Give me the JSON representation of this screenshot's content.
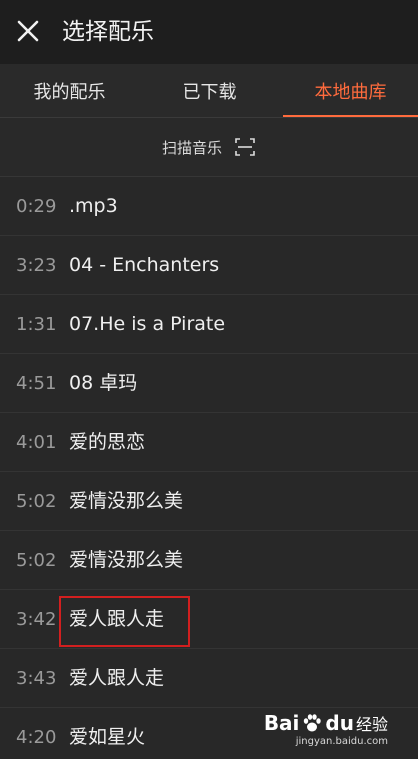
{
  "header": {
    "title": "选择配乐",
    "close_icon": "close-icon"
  },
  "tabs": [
    {
      "label": "我的配乐",
      "active": false
    },
    {
      "label": "已下载",
      "active": false
    },
    {
      "label": "本地曲库",
      "active": true
    }
  ],
  "accent_color": "#ff6b3d",
  "scan": {
    "label": "扫描音乐",
    "icon": "scan-icon"
  },
  "songs": [
    {
      "duration": "0:29",
      "title": ".mp3"
    },
    {
      "duration": "3:23",
      "title": "04 - Enchanters"
    },
    {
      "duration": "1:31",
      "title": "07.He is a Pirate"
    },
    {
      "duration": "4:51",
      "title": "08 卓玛"
    },
    {
      "duration": "4:01",
      "title": "爱的思恋"
    },
    {
      "duration": "5:02",
      "title": "爱情没那么美"
    },
    {
      "duration": "5:02",
      "title": "爱情没那么美"
    },
    {
      "duration": "3:42",
      "title": "爱人跟人走"
    },
    {
      "duration": "3:43",
      "title": "爱人跟人走"
    },
    {
      "duration": "4:20",
      "title": "爱如星火"
    }
  ],
  "watermark": {
    "brand_left": "Bai",
    "brand_right": "du",
    "jingyan": "经验",
    "url": "jingyan.baidu.com"
  }
}
